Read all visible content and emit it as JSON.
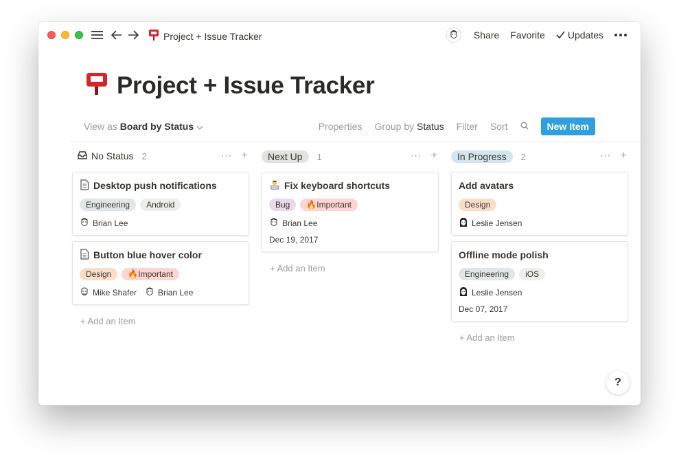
{
  "titlebar": {
    "breadcrumb": "Project + Issue Tracker",
    "share": "Share",
    "favorite": "Favorite",
    "updates": "Updates"
  },
  "page": {
    "title": "Project + Issue Tracker"
  },
  "viewbar": {
    "view_as_prefix": "View as",
    "view_name": "Board by Status",
    "properties": "Properties",
    "group_by_prefix": "Group by",
    "group_by_value": "Status",
    "filter": "Filter",
    "sort": "Sort",
    "new_item": "New Item"
  },
  "columns": [
    {
      "name": "No Status",
      "count": "2",
      "cards": [
        {
          "title": "Desktop push notifications",
          "icon": "page-icon",
          "tags": [
            "Engineering",
            "Android"
          ],
          "people": [
            "Brian Lee"
          ]
        },
        {
          "title": "Button blue hover color",
          "icon": "page-icon",
          "tags": [
            "Design",
            "🔥Important"
          ],
          "people": [
            "Mike Shafer",
            "Brian Lee"
          ]
        }
      ],
      "add_label": "+ Add an Item"
    },
    {
      "name": "Next Up",
      "count": "1",
      "cards": [
        {
          "title": "Fix keyboard shortcuts",
          "icon": "technologist-icon",
          "tags": [
            "Bug",
            "🔥Important"
          ],
          "people": [
            "Brian Lee"
          ],
          "date": "Dec 19, 2017"
        }
      ],
      "add_label": "+ Add an Item"
    },
    {
      "name": "In Progress",
      "count": "2",
      "cards": [
        {
          "title": "Add avatars",
          "tags": [
            "Design"
          ],
          "people": [
            "Leslie Jensen"
          ]
        },
        {
          "title": "Offline mode polish",
          "tags": [
            "Engineering",
            "iOS"
          ],
          "people": [
            "Leslie Jensen"
          ],
          "date": "Dec 07, 2017"
        }
      ],
      "add_label": "+ Add an Item"
    }
  ],
  "help": "?",
  "colors": {
    "new_item_bg": "#2f9fe0",
    "tag_engineering": "#e3e6e8",
    "tag_android": "#eeeeec",
    "tag_design": "#fadec9",
    "tag_important": "#ffd5d2",
    "tag_bug": "#ead8ec",
    "tag_ios": "#eeeeec",
    "pill_next_up": "#e3e2e0",
    "pill_in_progress": "#d3e5ef"
  }
}
